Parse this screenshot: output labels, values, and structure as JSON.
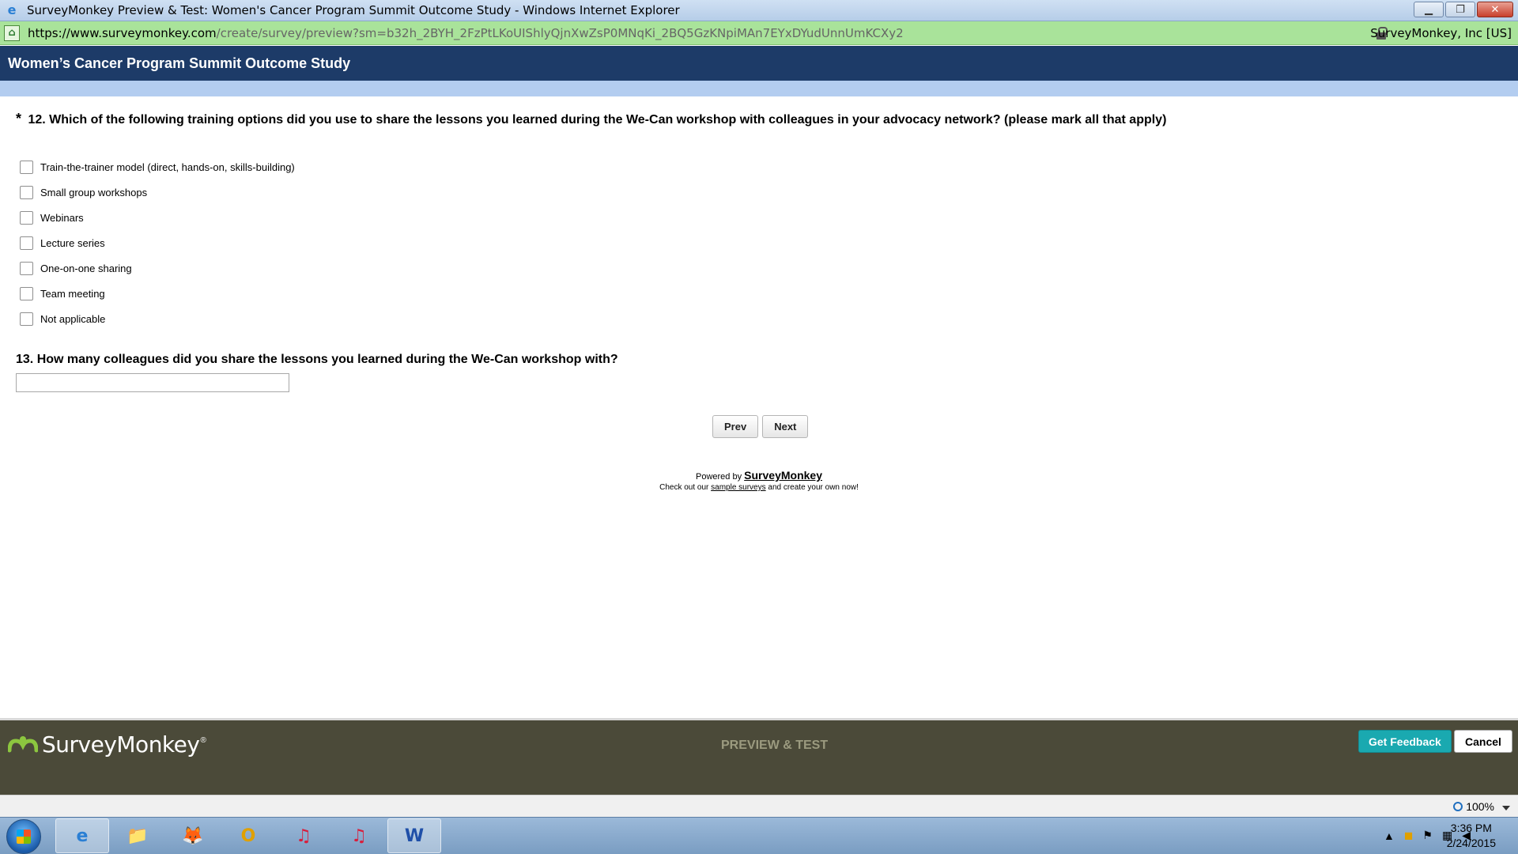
{
  "window": {
    "title": "SurveyMonkey Preview & Test: Women's Cancer Program Summit Outcome Study - Windows Internet Explorer",
    "minimize": "▁",
    "restore": "❐",
    "close": "✕"
  },
  "address_bar": {
    "url_host": "https://www.surveymonkey.com",
    "url_path": "/create/survey/preview?sm=b32h_2BYH_2FzPtLKoUIShlyQjnXwZsP0MNqKi_2BQ5GzKNpiMAn7EYxDYudUnnUmKCXy2",
    "certificate": "SurveyMonkey, Inc [US]"
  },
  "survey": {
    "title": "Women’s Cancer Program Summit Outcome Study",
    "q12": {
      "required_marker": "*",
      "text": "12. Which of the following training options did you use to share the lessons you learned during the We-Can workshop with colleagues in your advocacy network? (please mark all that apply)",
      "options": [
        {
          "label": "Train-the-trainer model (direct, hands-on, skills-building)",
          "checked": false
        },
        {
          "label": "Small group workshops",
          "checked": false
        },
        {
          "label": "Webinars",
          "checked": false
        },
        {
          "label": "Lecture series",
          "checked": false
        },
        {
          "label": "One-on-one sharing",
          "checked": false
        },
        {
          "label": "Team meeting",
          "checked": false
        },
        {
          "label": "Not applicable",
          "checked": false
        }
      ]
    },
    "q13": {
      "text": "13. How many colleagues did you share the lessons you learned during the We-Can workshop with?",
      "value": ""
    },
    "buttons": {
      "prev": "Prev",
      "next": "Next"
    },
    "footer": {
      "powered_by": "Powered by ",
      "brand": "SurveyMonkey",
      "checkout_prefix": "Check out our ",
      "checkout_link": "sample surveys",
      "checkout_suffix": " and create your own now!"
    }
  },
  "preview_bar": {
    "logo": "SurveyMonkey",
    "logo_reg": "®",
    "label": "PREVIEW & TEST",
    "get_feedback": "Get Feedback",
    "cancel": "Cancel"
  },
  "statusbar": {
    "zoom": "100%"
  },
  "taskbar": {
    "apps": [
      "e",
      "📁",
      "🦊",
      "O",
      "♫",
      "♫",
      "W"
    ],
    "time": "3:36 PM",
    "date": "2/24/2015"
  },
  "colors": {
    "header": "#1d3b68",
    "address_bar": "#a9e39a",
    "preview_bar": "#4b4a39",
    "get_feedback": "#1aa9b0"
  }
}
